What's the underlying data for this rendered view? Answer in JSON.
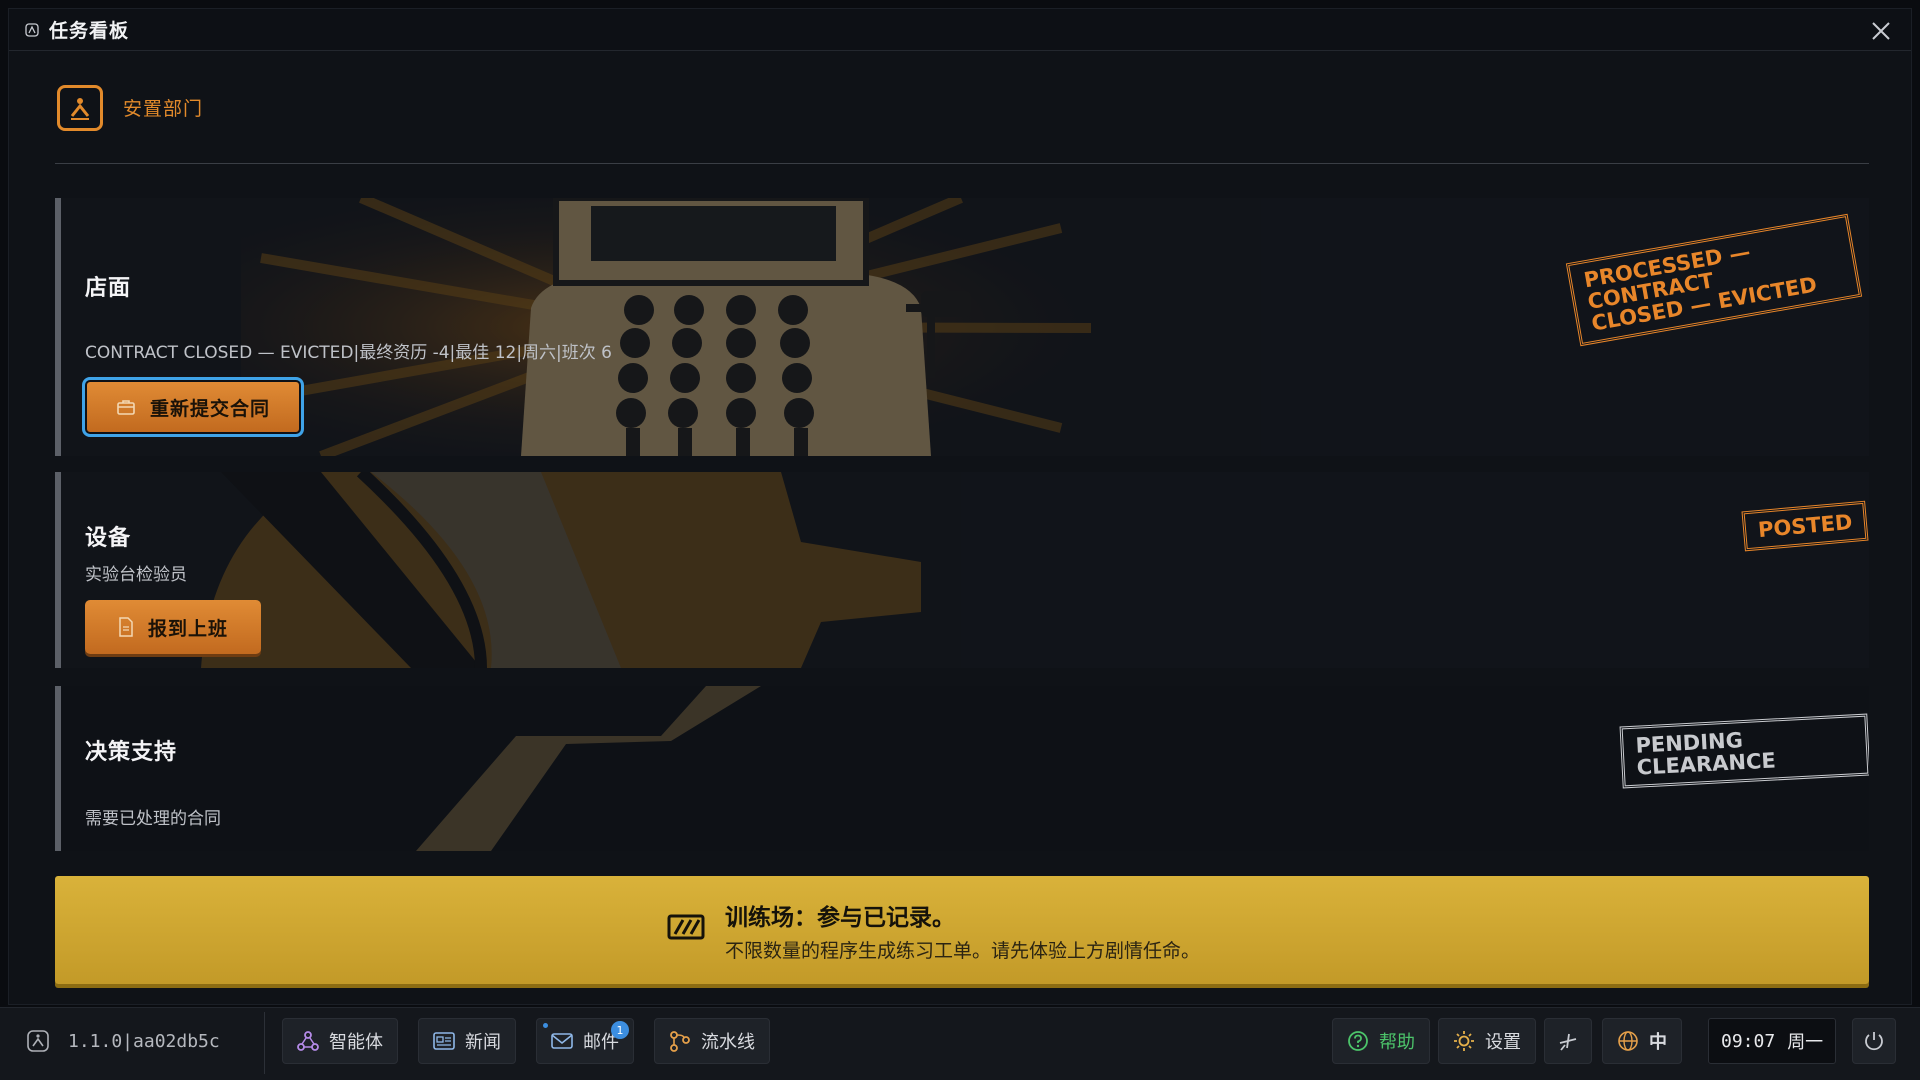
{
  "window": {
    "title": "任务看板"
  },
  "department": {
    "name": "安置部门"
  },
  "cards": [
    {
      "title": "店面",
      "subtitle": "CONTRACT CLOSED — EVICTED|最终资历 -4|最佳 12|周六|班次 6",
      "button": "重新提交合同",
      "stamp": [
        "PROCESSED — CONTRACT",
        "CLOSED — EVICTED"
      ]
    },
    {
      "title": "设备",
      "subtitle": "实验台检验员",
      "button": "报到上班",
      "stamp": [
        "POSTED"
      ]
    },
    {
      "title": "决策支持",
      "subtitle": "需要已处理的合同",
      "stamp": [
        "PENDING CLEARANCE"
      ]
    }
  ],
  "banner": {
    "title": "训练场：参与已记录。",
    "text": "不限数量的程序生成练习工单。请先体验上方剧情任命。"
  },
  "taskbar": {
    "version": "1.1.0|aa02db5c",
    "agents": "智能体",
    "news": "新闻",
    "mail": "邮件",
    "mail_badge": "1",
    "pipeline": "流水线",
    "help": "帮助",
    "settings": "设置",
    "language": "中",
    "time": "09:07",
    "weekday": "周一"
  },
  "colors": {
    "accent": "#e28a2b",
    "banner": "#d4ac35",
    "help_green": "#4cc46a",
    "focus": "#3fa3e8"
  }
}
